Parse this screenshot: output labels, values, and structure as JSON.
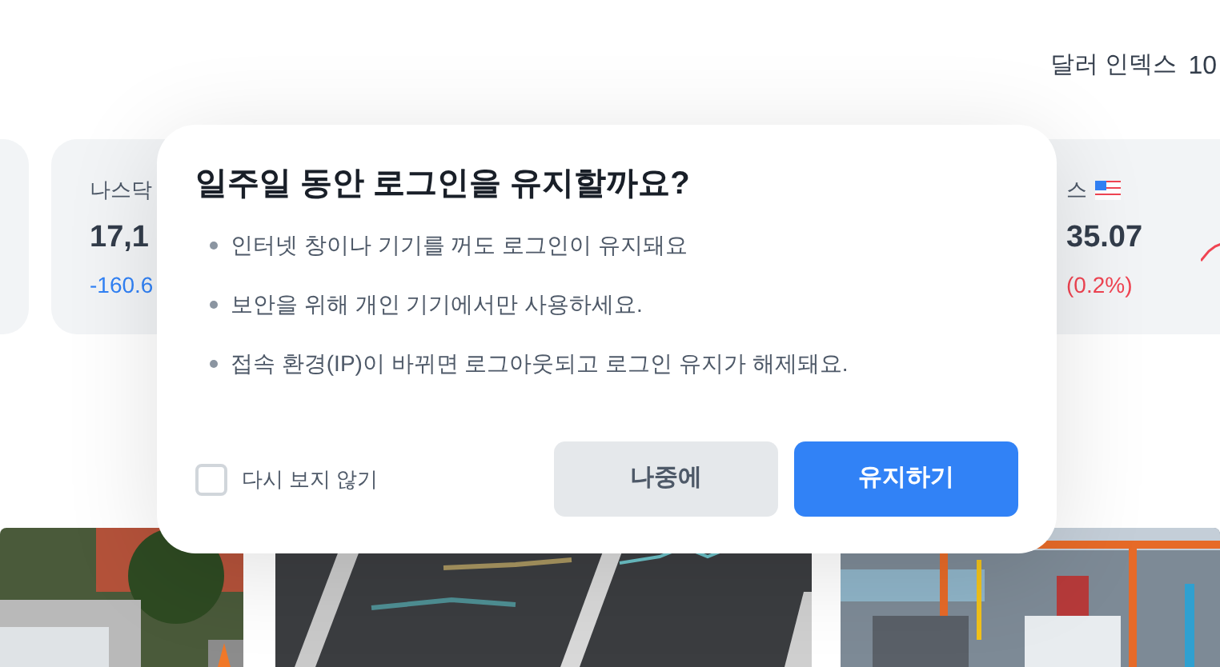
{
  "header": {
    "label": "달러 인덱스",
    "value": "10"
  },
  "index_cards": [
    {
      "kind": "stub"
    },
    {
      "kind": "full",
      "name": "나스닥",
      "value": "17,1",
      "change": "-160.6",
      "color": "#3182f6"
    },
    {
      "kind": "full",
      "name": "스",
      "flag": true,
      "value": "35.07",
      "change": "(0.2%)",
      "color": "#f04452"
    }
  ],
  "dialog": {
    "title": "일주일 동안 로그인을 유지할까요?",
    "notes": [
      "인터넷 창이나 기기를 꺼도 로그인이 유지돼요",
      "보안을 위해 개인 기기에서만 사용하세요.",
      "접속 환경(IP)이 바뀌면 로그아웃되고 로그인 유지가 해제돼요."
    ],
    "dont_show_again": {
      "label": "다시 보지 않기",
      "checked": false
    },
    "buttons": [
      {
        "label": "나중에",
        "kind": "secondary"
      },
      {
        "label": "유지하기",
        "kind": "primary"
      }
    ]
  }
}
